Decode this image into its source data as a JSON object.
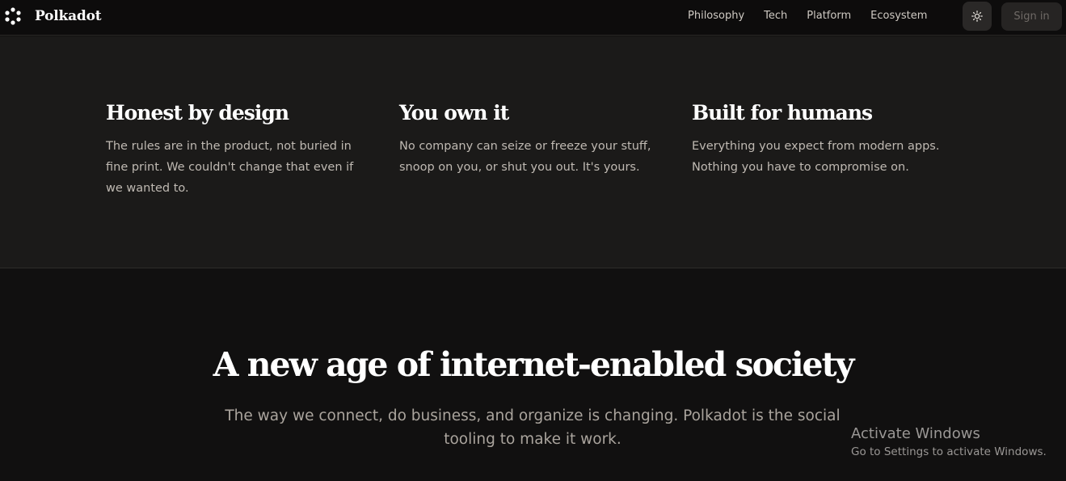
{
  "nav": {
    "brand": "Polkadot",
    "links": [
      "Philosophy",
      "Tech",
      "Platform",
      "Ecosystem"
    ],
    "theme_icon": "sun-icon",
    "signin_label": "Sign in"
  },
  "features": [
    {
      "title": "Honest by design",
      "text": "The rules are in the product, not buried in fine print. We couldn't change that even if we wanted to."
    },
    {
      "title": "You own it",
      "text": "No company can seize or freeze your stuff, snoop on you, or shut you out. It's yours."
    },
    {
      "title": "Built for humans",
      "text": "Everything you expect from modern apps. Nothing you have to compromise on."
    }
  ],
  "hero": {
    "title": "A new age of internet-enabled society",
    "subtitle": "The way we connect, do business, and organize is changing. Polkadot is the social tooling to make it work."
  },
  "watermark": {
    "title": "Activate Windows",
    "subtitle": "Go to Settings to activate Windows."
  }
}
